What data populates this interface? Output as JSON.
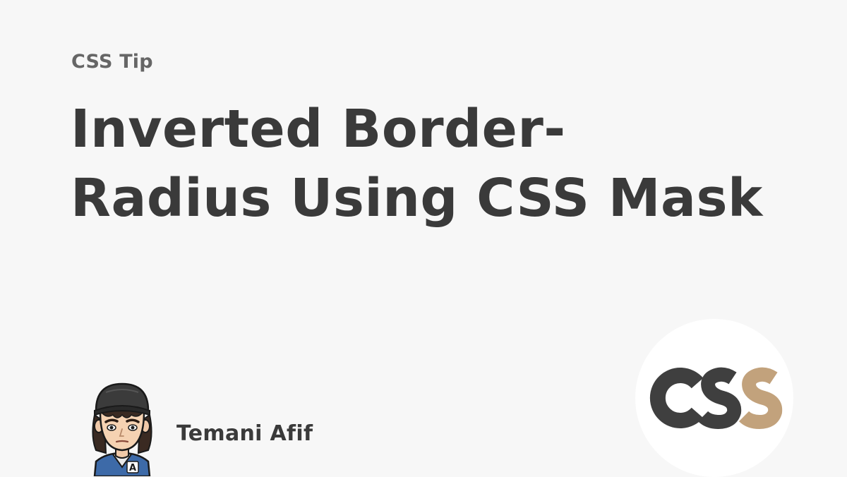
{
  "header": {
    "eyebrow": "CSS Tip"
  },
  "title": {
    "line1": "Inverted Border-",
    "line2": "Radius Using CSS Mask"
  },
  "author": {
    "name": "Temani Afif",
    "avatar_icon": "cartoon-avatar-icon",
    "avatar_badge_letter": "A"
  },
  "logo": {
    "text": "CSS",
    "icon": "css-logo-icon",
    "colors": {
      "primary": "#3f3f3f",
      "accent": "#c2a27c"
    }
  },
  "colors": {
    "background": "#f7f7f7",
    "heading": "#3a3a3a",
    "eyebrow": "#666666"
  }
}
